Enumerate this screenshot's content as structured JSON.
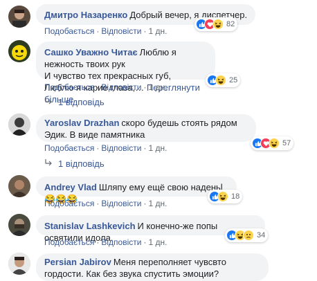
{
  "actions": {
    "like": "Подобається",
    "reply": "Відповісти",
    "sep": "·"
  },
  "comments": [
    {
      "name": "Дмитро Назаренко",
      "text": "Добрый вечер, я диспетчер.",
      "time": "1 дн.",
      "reactions_count": "82",
      "reactions": [
        "like",
        "love",
        "haha"
      ]
    },
    {
      "name": "Сашко Уважно Читає",
      "lines": [
        "Люблю я нежность твоих рук",
        "И чувство тех прекрасных губ,",
        "Люблю я карие глаза,…"
      ],
      "more": "Переглянути більше",
      "time": "1 дн.",
      "reactions_count": "25",
      "reactions": [
        "like",
        "haha"
      ],
      "replies": "1 відповідь"
    },
    {
      "name": "Yaroslav Drazhan",
      "text": "скоро будешь стоять рядом Эдик. В виде памятника",
      "time": "1 дн.",
      "reactions_count": "57",
      "reactions": [
        "like",
        "love",
        "haha"
      ],
      "replies": "1 відповідь"
    },
    {
      "name": "Andrey Vlad",
      "text": "Шляпу ему ещё свою наденьl",
      "emoji": "😂😂😂",
      "time": "1 дн.",
      "reactions_count": "18",
      "reactions": [
        "like",
        "haha"
      ]
    },
    {
      "name": "Stanislav Lashkevich",
      "text": "И конечно-же попы освятили идола.",
      "time": "1 дн.",
      "reactions_count": "34",
      "reactions": [
        "like",
        "haha",
        "sad"
      ]
    },
    {
      "name": "Persian Jabirov",
      "text": "Меня переполняет чувсвто гордости. Как без звука спустить эмоции?"
    }
  ]
}
